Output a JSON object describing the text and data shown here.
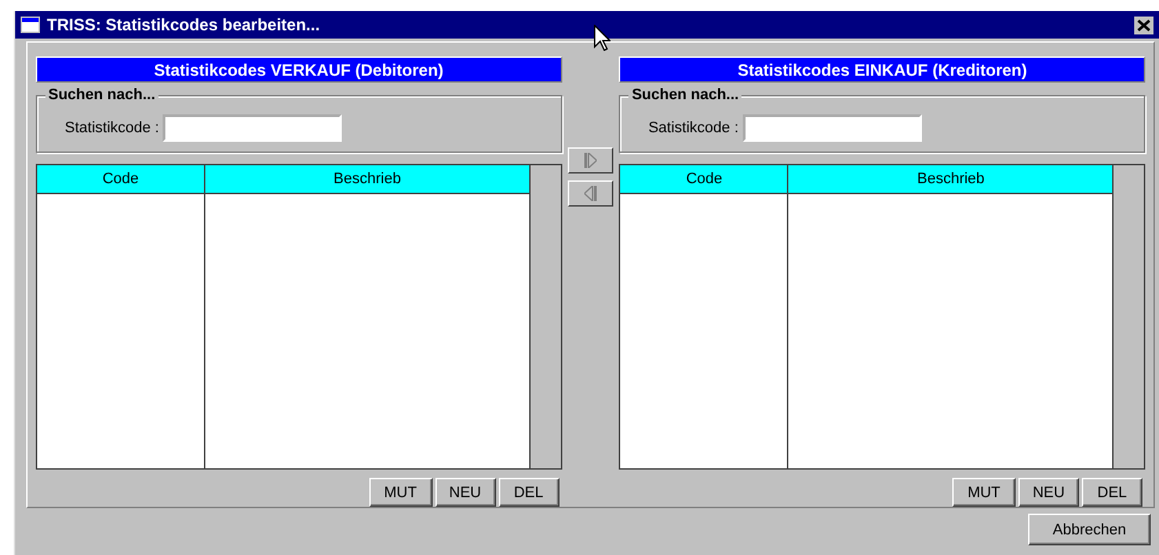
{
  "window": {
    "title": "TRISS: Statistikcodes bearbeiten..."
  },
  "panels": [
    {
      "title": "Statistikcodes VERKAUF (Debitoren)",
      "search": {
        "legend": "Suchen nach...",
        "label": "Statistikcode :"
      },
      "columns": [
        "Code",
        "Beschrieb"
      ],
      "buttons": [
        "MUT",
        "NEU",
        "DEL"
      ]
    },
    {
      "title": "Statistikcodes EINKAUF (Kreditoren)",
      "search": {
        "legend": "Suchen nach...",
        "label": "Satistikcode :"
      },
      "columns": [
        "Code",
        "Beschrieb"
      ],
      "buttons": [
        "MUT",
        "NEU",
        "DEL"
      ]
    }
  ],
  "transfer_buttons": [
    {
      "kind": "right"
    },
    {
      "kind": "left"
    }
  ],
  "footer_buttons": [
    "Abbrechen"
  ]
}
